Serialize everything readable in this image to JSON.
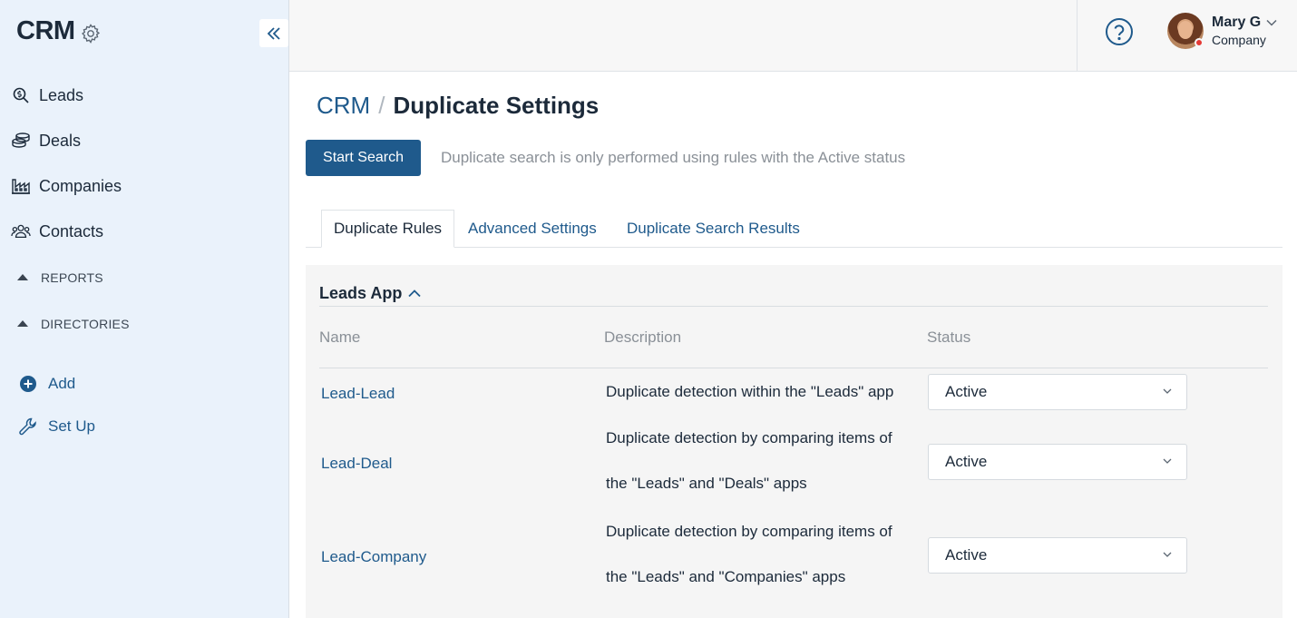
{
  "app": {
    "title": "CRM"
  },
  "sidebar": {
    "items": [
      {
        "label": "Leads",
        "icon": "search-dollar-icon"
      },
      {
        "label": "Deals",
        "icon": "coins-icon"
      },
      {
        "label": "Companies",
        "icon": "factory-icon"
      },
      {
        "label": "Contacts",
        "icon": "people-icon"
      }
    ],
    "sections": [
      {
        "label": "REPORTS"
      },
      {
        "label": "DIRECTORIES"
      }
    ],
    "actions": [
      {
        "label": "Add",
        "icon": "plus-circle-icon"
      },
      {
        "label": "Set Up",
        "icon": "wrench-icon"
      }
    ]
  },
  "user": {
    "name": "Mary G",
    "company": "Company",
    "status_color": "#e53935"
  },
  "breadcrumb": {
    "root": "CRM",
    "separator": "/",
    "current": "Duplicate Settings"
  },
  "toolbar": {
    "start_label": "Start Search",
    "hint": "Duplicate search is only performed using rules with the Active status"
  },
  "tabs": [
    {
      "label": "Duplicate Rules",
      "active": true
    },
    {
      "label": "Advanced Settings",
      "active": false
    },
    {
      "label": "Duplicate Search Results",
      "active": false
    }
  ],
  "panel": {
    "title": "Leads App",
    "columns": [
      "Name",
      "Description",
      "Status"
    ],
    "rows": [
      {
        "name": "Lead-Lead",
        "desc_lines": [
          "Duplicate detection within the \"Leads\" app"
        ],
        "status": "Active"
      },
      {
        "name": "Lead-Deal",
        "desc_lines": [
          "Duplicate detection by comparing items of",
          "the \"Leads\" and \"Deals\" apps"
        ],
        "status": "Active"
      },
      {
        "name": "Lead-Company",
        "desc_lines": [
          "Duplicate detection by comparing items of",
          "the \"Leads\" and \"Companies\" apps"
        ],
        "status": "Active"
      }
    ]
  },
  "colors": {
    "accent": "#1f5a8c",
    "sidebar_bg": "#eaf2fb",
    "muted_text": "#8a9097"
  }
}
